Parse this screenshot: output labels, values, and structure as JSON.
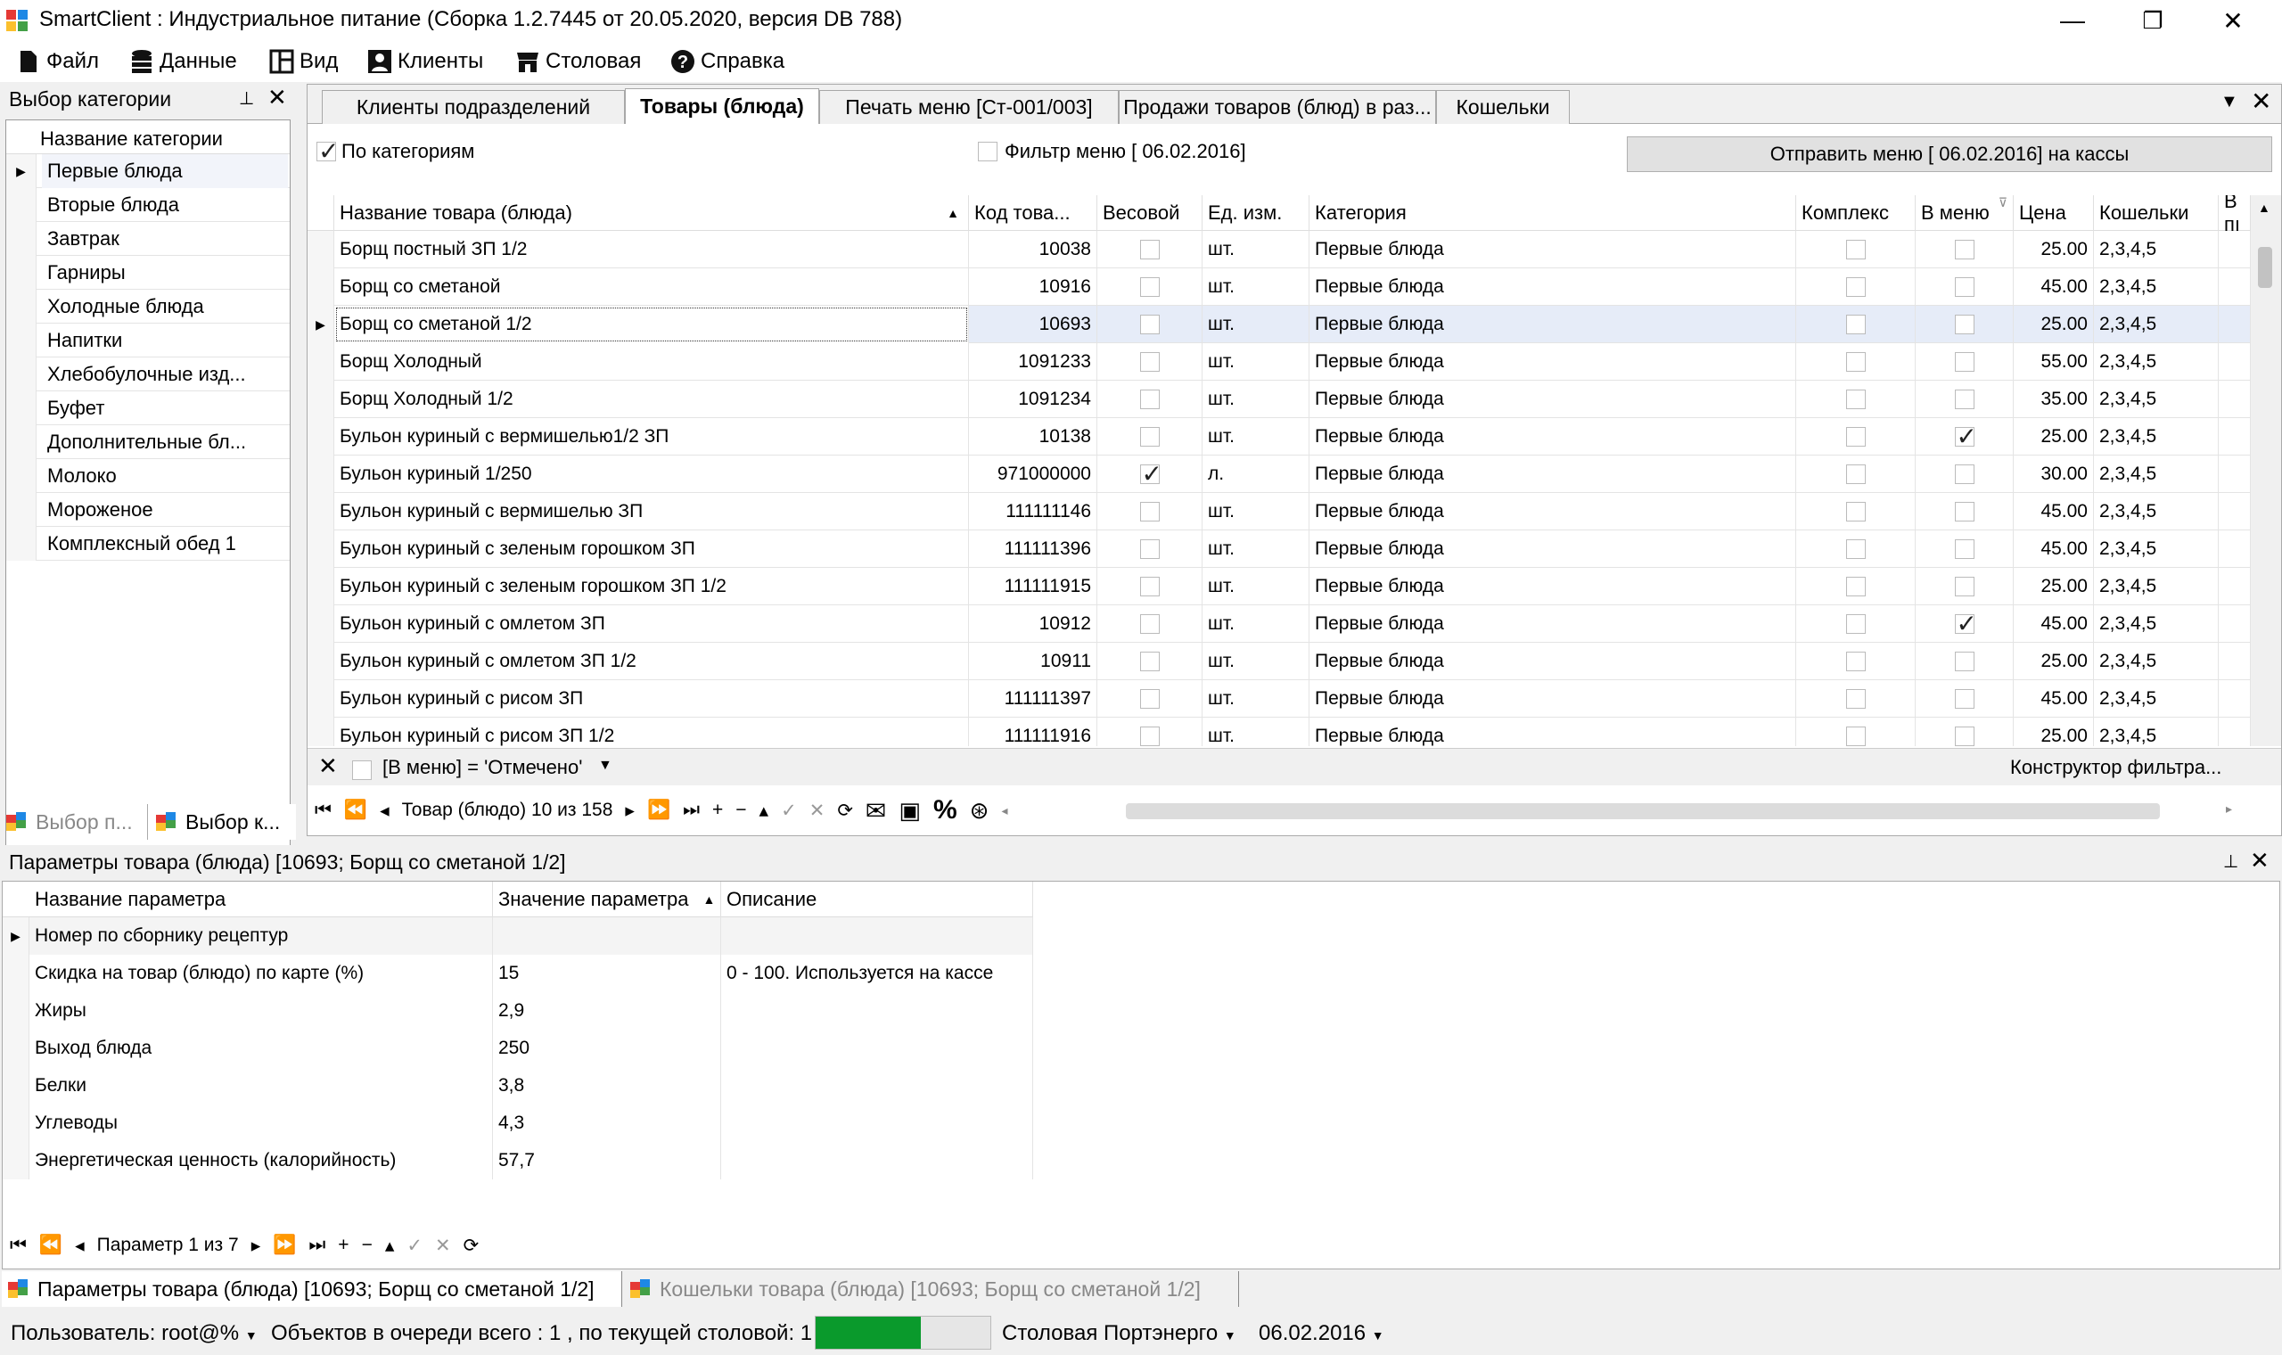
{
  "window": {
    "title": "SmartClient : Индустриальное питание (Сборка 1.2.7445 от 20.05.2020, версия DB 788)",
    "minimize": "—",
    "restore": "❐",
    "close": "✕"
  },
  "menu": [
    {
      "label": "Файл",
      "icon": "file-icon"
    },
    {
      "label": "Данные",
      "icon": "database-icon"
    },
    {
      "label": "Вид",
      "icon": "layout-icon"
    },
    {
      "label": "Клиенты",
      "icon": "person-icon"
    },
    {
      "label": "Столовая",
      "icon": "store-icon"
    },
    {
      "label": "Справка",
      "icon": "help-icon"
    }
  ],
  "category_panel": {
    "title": "Выбор категории",
    "pin": "📌",
    "close": "✕",
    "column": "Название категории",
    "items": [
      "Первые блюда",
      "Вторые блюда",
      "Завтрак",
      "Гарниры",
      "Холодные блюда",
      "Напитки",
      "Хлебобулочные изд...",
      "Буфет",
      "Дополнительные бл...",
      "Молоко",
      "Мороженое",
      "Комплексный обед 1"
    ],
    "bottom_tabs": [
      "Выбор п...",
      "Выбор к..."
    ]
  },
  "main_tabs": [
    "Клиенты подразделений",
    "Товары (блюда)",
    "Печать меню [Ст-001/003]",
    "Продажи товаров (блюд) в раз...",
    "Кошельки"
  ],
  "toolbar": {
    "by_category": "По категориям",
    "filter_menu": "Фильтр меню [ 06.02.2016]",
    "send_button": "Отправить меню [ 06.02.2016] на кассы"
  },
  "goods_table": {
    "columns": [
      "Название товара (блюда)",
      "Код това...",
      "Весовой",
      "Ед. изм.",
      "Категория",
      "Комплекс",
      "В меню",
      "Цена",
      "Кошельки",
      "В пı"
    ],
    "rows": [
      {
        "name": "Борщ постный ЗП 1/2",
        "code": "10038",
        "weight": false,
        "unit": "шт.",
        "category": "Первые блюда",
        "complex": false,
        "menu": false,
        "price": "25.00",
        "wallets": "2,3,4,5"
      },
      {
        "name": "Борщ со сметаной",
        "code": "10916",
        "weight": false,
        "unit": "шт.",
        "category": "Первые блюда",
        "complex": false,
        "menu": false,
        "price": "45.00",
        "wallets": "2,3,4,5"
      },
      {
        "name": "Борщ со сметаной 1/2",
        "code": "10693",
        "weight": false,
        "unit": "шт.",
        "category": "Первые блюда",
        "complex": false,
        "menu": false,
        "price": "25.00",
        "wallets": "2,3,4,5"
      },
      {
        "name": "Борщ Холодный",
        "code": "1091233",
        "weight": false,
        "unit": "шт.",
        "category": "Первые блюда",
        "complex": false,
        "menu": false,
        "price": "55.00",
        "wallets": "2,3,4,5"
      },
      {
        "name": "Борщ Холодный 1/2",
        "code": "1091234",
        "weight": false,
        "unit": "шт.",
        "category": "Первые блюда",
        "complex": false,
        "menu": false,
        "price": "35.00",
        "wallets": "2,3,4,5"
      },
      {
        "name": "Бульон  куриный  с вермишелью1/2 ЗП",
        "code": "10138",
        "weight": false,
        "unit": "шт.",
        "category": "Первые блюда",
        "complex": false,
        "menu": true,
        "price": "25.00",
        "wallets": "2,3,4,5"
      },
      {
        "name": "Бульон куриный 1/250",
        "code": "971000000",
        "weight": true,
        "unit": "л.",
        "category": "Первые блюда",
        "complex": false,
        "menu": false,
        "price": "30.00",
        "wallets": "2,3,4,5"
      },
      {
        "name": "Бульон куриный с вермишелью ЗП",
        "code": "111111146",
        "weight": false,
        "unit": "шт.",
        "category": "Первые блюда",
        "complex": false,
        "menu": false,
        "price": "45.00",
        "wallets": "2,3,4,5"
      },
      {
        "name": "Бульон куриный с зеленым горошком ЗП",
        "code": "111111396",
        "weight": false,
        "unit": "шт.",
        "category": "Первые блюда",
        "complex": false,
        "menu": false,
        "price": "45.00",
        "wallets": "2,3,4,5"
      },
      {
        "name": "Бульон куриный с зеленым горошком ЗП 1/2",
        "code": "111111915",
        "weight": false,
        "unit": "шт.",
        "category": "Первые блюда",
        "complex": false,
        "menu": false,
        "price": "25.00",
        "wallets": "2,3,4,5"
      },
      {
        "name": "Бульон куриный с омлетом ЗП",
        "code": "10912",
        "weight": false,
        "unit": "шт.",
        "category": "Первые блюда",
        "complex": false,
        "menu": true,
        "price": "45.00",
        "wallets": "2,3,4,5"
      },
      {
        "name": "Бульон куриный с омлетом ЗП 1/2",
        "code": "10911",
        "weight": false,
        "unit": "шт.",
        "category": "Первые блюда",
        "complex": false,
        "menu": false,
        "price": "25.00",
        "wallets": "2,3,4,5"
      },
      {
        "name": "Бульон куриный с рисом ЗП",
        "code": "111111397",
        "weight": false,
        "unit": "шт.",
        "category": "Первые блюда",
        "complex": false,
        "menu": false,
        "price": "45.00",
        "wallets": "2,3,4,5"
      },
      {
        "name": "Бульон куриный с рисом ЗП 1/2",
        "code": "111111916",
        "weight": false,
        "unit": "шт.",
        "category": "Первые блюда",
        "complex": false,
        "menu": false,
        "price": "25.00",
        "wallets": "2,3,4,5"
      }
    ]
  },
  "filter_bar": {
    "expression": "[В меню] = 'Отмечено'",
    "constructor": "Конструктор фильтра..."
  },
  "goods_nav": {
    "record": "Товар (блюдо) 10 из 158"
  },
  "params_panel": {
    "title": "Параметры товара (блюда) [10693; Борщ со сметаной 1/2]",
    "columns": [
      "Название параметра",
      "Значение параметра",
      "Описание"
    ],
    "rows": [
      {
        "name": "Номер по сборнику рецептур",
        "value": "",
        "desc": ""
      },
      {
        "name": "Скидка на товар (блюдо) по карте (%)",
        "value": "15",
        "desc": "0 - 100. Используется на кассе"
      },
      {
        "name": "Жиры",
        "value": "2,9",
        "desc": ""
      },
      {
        "name": "Выход блюда",
        "value": "250",
        "desc": ""
      },
      {
        "name": "Белки",
        "value": "3,8",
        "desc": ""
      },
      {
        "name": "Углеводы",
        "value": "4,3",
        "desc": ""
      },
      {
        "name": "Энергетическая ценность (калорийность)",
        "value": "57,7",
        "desc": ""
      }
    ],
    "nav": "Параметр 1 из 7"
  },
  "bottom_tabs": [
    "Параметры товара (блюда) [10693; Борщ со сметаной 1/2]",
    "Кошельки товара (блюда) [10693; Борщ со сметаной 1/2]"
  ],
  "status": {
    "user": "Пользователь: root@%",
    "queue": "Объектов в очереди всего : 1 , по текущей столовой: 1",
    "progress": 0.6,
    "canteen": "Столовая Портэнерго",
    "date": "06.02.2016"
  },
  "colors": {
    "accent": "#0a9a2c",
    "selected_row": "#e6ecf8"
  }
}
